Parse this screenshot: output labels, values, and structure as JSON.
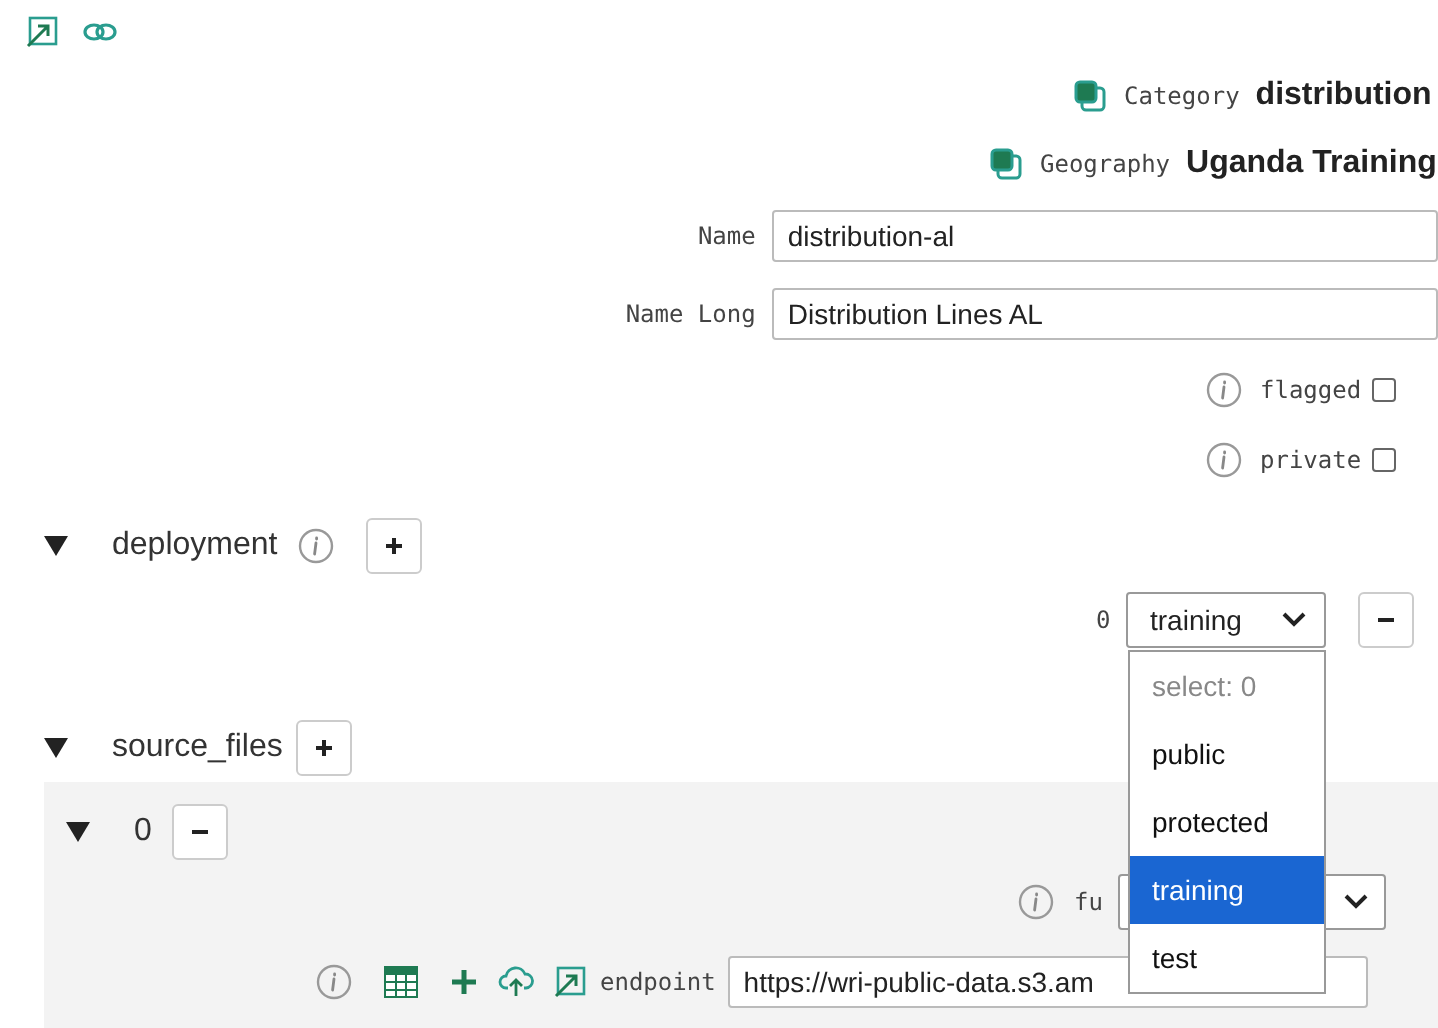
{
  "category": {
    "label": "Category",
    "value": "distribution"
  },
  "geography": {
    "label": "Geography",
    "value": "Uganda Training"
  },
  "fields": [
    {
      "label": "Name",
      "value": "distribution-al"
    },
    {
      "label": "Name Long",
      "value": "Distribution Lines AL"
    }
  ],
  "flags": [
    {
      "label": "flagged",
      "checked": false
    },
    {
      "label": "private",
      "checked": false
    }
  ],
  "deployment": {
    "label": "deployment",
    "expanded": true,
    "items": [
      {
        "index": "0",
        "value": "training"
      }
    ],
    "dropdown": {
      "placeholder": "select: 0",
      "options": [
        {
          "label": "public",
          "selected": false
        },
        {
          "label": "protected",
          "selected": false
        },
        {
          "label": "training",
          "selected": true
        },
        {
          "label": "test",
          "selected": false
        }
      ]
    }
  },
  "source_files": {
    "label": "source_files",
    "expanded": true,
    "items": [
      {
        "index": "0",
        "expanded": true,
        "select_label": "fu",
        "endpoint": {
          "label": "endpoint",
          "value": "https://wri-public-data.s3.am"
        }
      }
    ]
  }
}
